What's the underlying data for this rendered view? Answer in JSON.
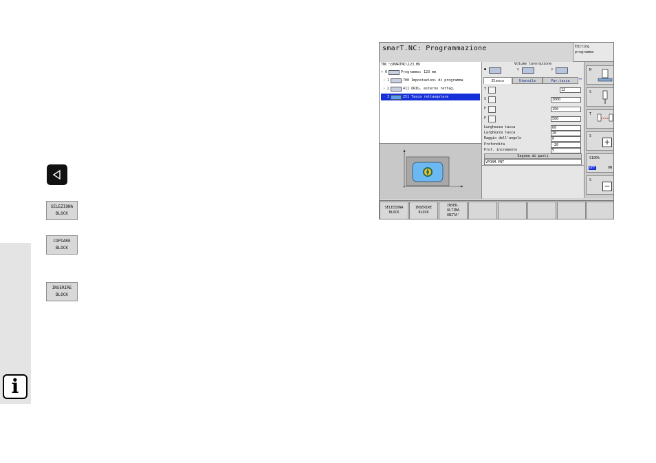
{
  "screen": {
    "title": "smarT.NC: Programmazione",
    "mode": [
      "Editing",
      "programma"
    ],
    "tree": {
      "path": "TNC:\\SMARTNC\\123.HU",
      "rows": [
        {
          "num": "0",
          "text": "Programma: 123 mm"
        },
        {
          "num": "1",
          "text": "700 Impostazioni di programma"
        },
        {
          "num": "2",
          "text": "411 ORIG. esterno rettag."
        },
        {
          "num": "3",
          "text": "251 Tasca rettangolare"
        }
      ]
    },
    "form": {
      "volume_label": "Volume lavorazione",
      "tabs": [
        "Elenco",
        "Utensile",
        "Par.tasca"
      ],
      "tool_rows": [
        {
          "key": "T",
          "value": "12"
        },
        {
          "key": "S",
          "value": "3000"
        },
        {
          "key": "F",
          "value": "150"
        },
        {
          "key": "F",
          "value": "500"
        }
      ],
      "params": [
        {
          "label": "Lunghezza tasca",
          "value": "60"
        },
        {
          "label": "Larghezza tasca",
          "value": "20"
        },
        {
          "label": "Raggio dell'angolo",
          "value": "0"
        },
        {
          "label": "Profondita",
          "value": "-20"
        },
        {
          "label": "Prof. incremento",
          "value": "5"
        }
      ],
      "pattern_title": "Sagoma di punti",
      "pattern_value": "VFORM.PNT"
    },
    "vsoftkeys": {
      "m": "M",
      "s": "S",
      "t": "T",
      "s_plus": "S",
      "s100": "S100%",
      "off": "OFF",
      "on": "ON",
      "s_minus": "S"
    },
    "hsoftkeys": [
      [
        "SELEZIONA",
        "BLOCK"
      ],
      [
        "INSERIRE",
        "BLOCK"
      ],
      [
        "INSER.",
        "ULTIMA",
        "UNITA'"
      ],
      [
        ""
      ],
      [
        ""
      ],
      [
        ""
      ],
      [
        ""
      ],
      [
        ""
      ]
    ]
  },
  "page": {
    "softkeys": [
      [
        "SELEZIONA",
        "BLOCK"
      ],
      [
        "COPIARE",
        "BLOCK"
      ],
      [
        "INSERIRE",
        "BLOCK"
      ]
    ],
    "info_icon": "i"
  },
  "colors": {
    "select": "#1530d8",
    "screen_bg": "#d6d6d6"
  }
}
